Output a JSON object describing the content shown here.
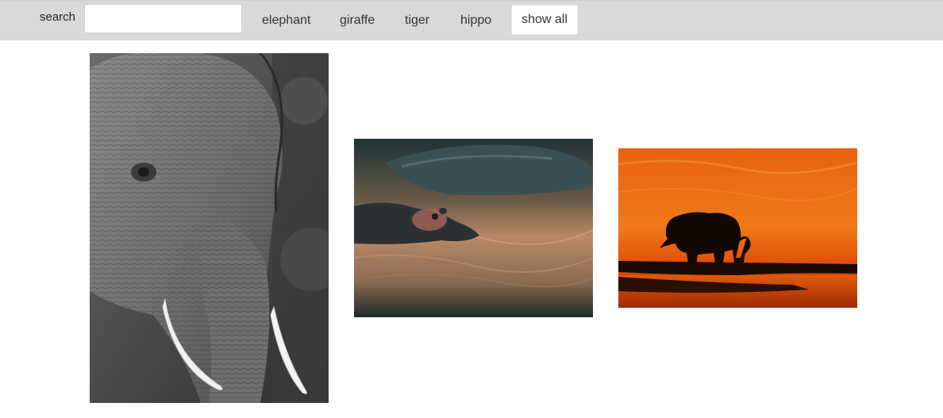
{
  "search": {
    "label": "search",
    "value": "",
    "placeholder": ""
  },
  "filters": [
    {
      "label": "elephant"
    },
    {
      "label": "giraffe"
    },
    {
      "label": "tiger"
    },
    {
      "label": "hippo"
    }
  ],
  "show_all_label": "show all",
  "gallery": [
    {
      "subject": "elephant",
      "style": "black-and-white close-up"
    },
    {
      "subject": "hippo",
      "style": "in muddy water"
    },
    {
      "subject": "elephant",
      "style": "silhouette at orange sunset"
    }
  ],
  "colors": {
    "toolbar_bg": "#d9d9d9",
    "button_bg": "#ffffff",
    "text": "#333333",
    "sunset_orange": "#e0500a"
  }
}
